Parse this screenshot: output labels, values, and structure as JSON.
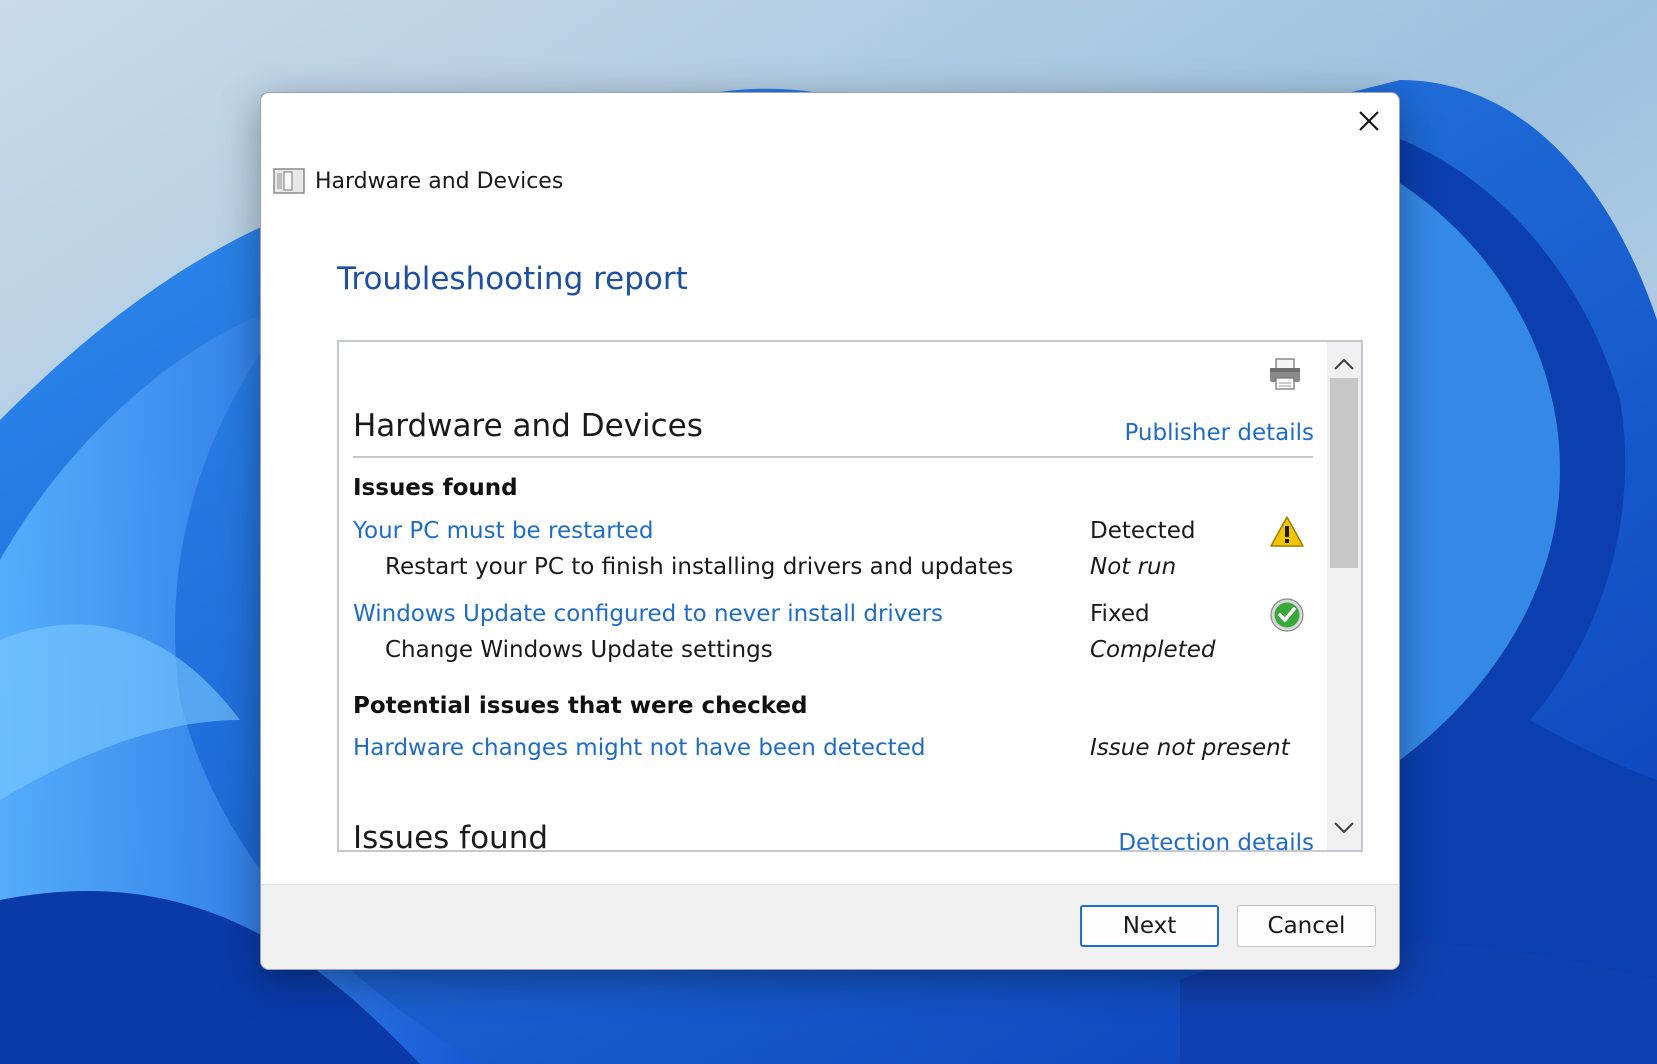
{
  "window": {
    "title": "Hardware and Devices",
    "close_icon": "close-icon",
    "app_icon": "hardware-devices-icon"
  },
  "page": {
    "heading": "Troubleshooting report"
  },
  "report": {
    "print_icon": "printer-icon",
    "section_title": "Hardware and Devices",
    "publisher_link": "Publisher details",
    "issues_found_heading": "Issues found",
    "issues": [
      {
        "title": "Your PC must be restarted",
        "status": "Detected",
        "status_icon": "warning-icon",
        "action": "Restart your PC to finish installing drivers and updates",
        "action_status": "Not run"
      },
      {
        "title": "Windows Update configured to never install drivers",
        "status": "Fixed",
        "status_icon": "check-icon",
        "action": "Change Windows Update settings",
        "action_status": "Completed"
      }
    ],
    "potential_heading": "Potential issues that were checked",
    "potential": [
      {
        "title": "Hardware changes might not have been detected",
        "status": "Issue not present"
      }
    ],
    "next_section_title": "Issues found",
    "detection_link": "Detection details"
  },
  "footer": {
    "next_label": "Next",
    "cancel_label": "Cancel"
  },
  "colors": {
    "accent": "#1d4fa3",
    "link": "#1e6cc8",
    "warning": "#f5c400",
    "success": "#3aa83a"
  }
}
